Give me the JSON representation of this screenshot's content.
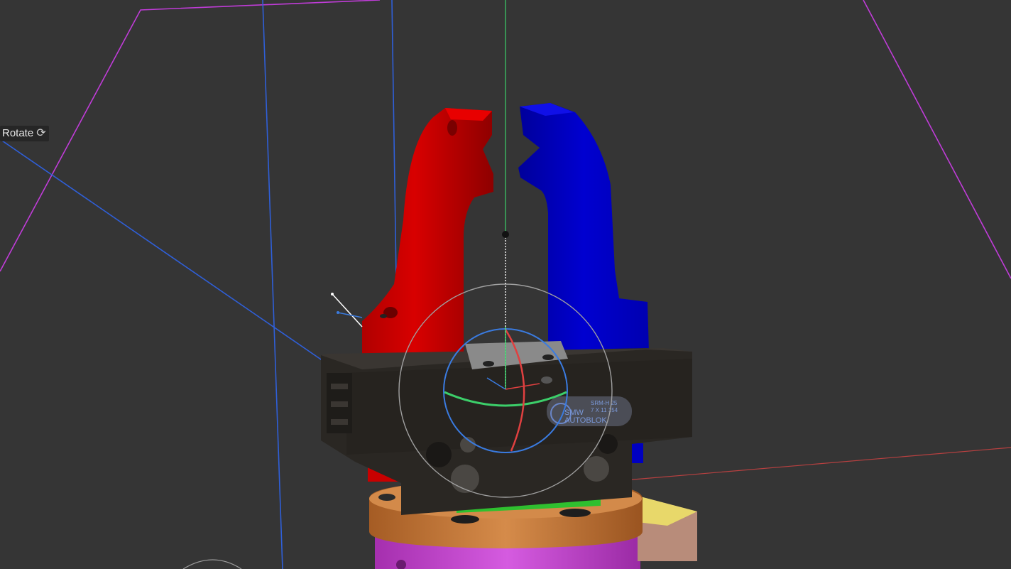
{
  "viewport": {
    "mode_label": "Rotate",
    "mode_icon": "rotate-icon",
    "brand_plate": {
      "line1": "SMW",
      "line2": "AUTOBLOK",
      "model": "SRM-H 25",
      "serial": "7 X 11 154"
    }
  },
  "colors": {
    "background": "#353535",
    "left_jaw": "#c80000",
    "right_jaw": "#0000c8",
    "gripper_body": "#2a2723",
    "flange": "#c87a3c",
    "base": "#c040c8",
    "pcb": "#2fbf2f",
    "block": "#e8d86a",
    "axis_x": "#e04040",
    "axis_y": "#3ccf6a",
    "axis_z": "#3a7be0",
    "frustum": "#c03cd8"
  }
}
